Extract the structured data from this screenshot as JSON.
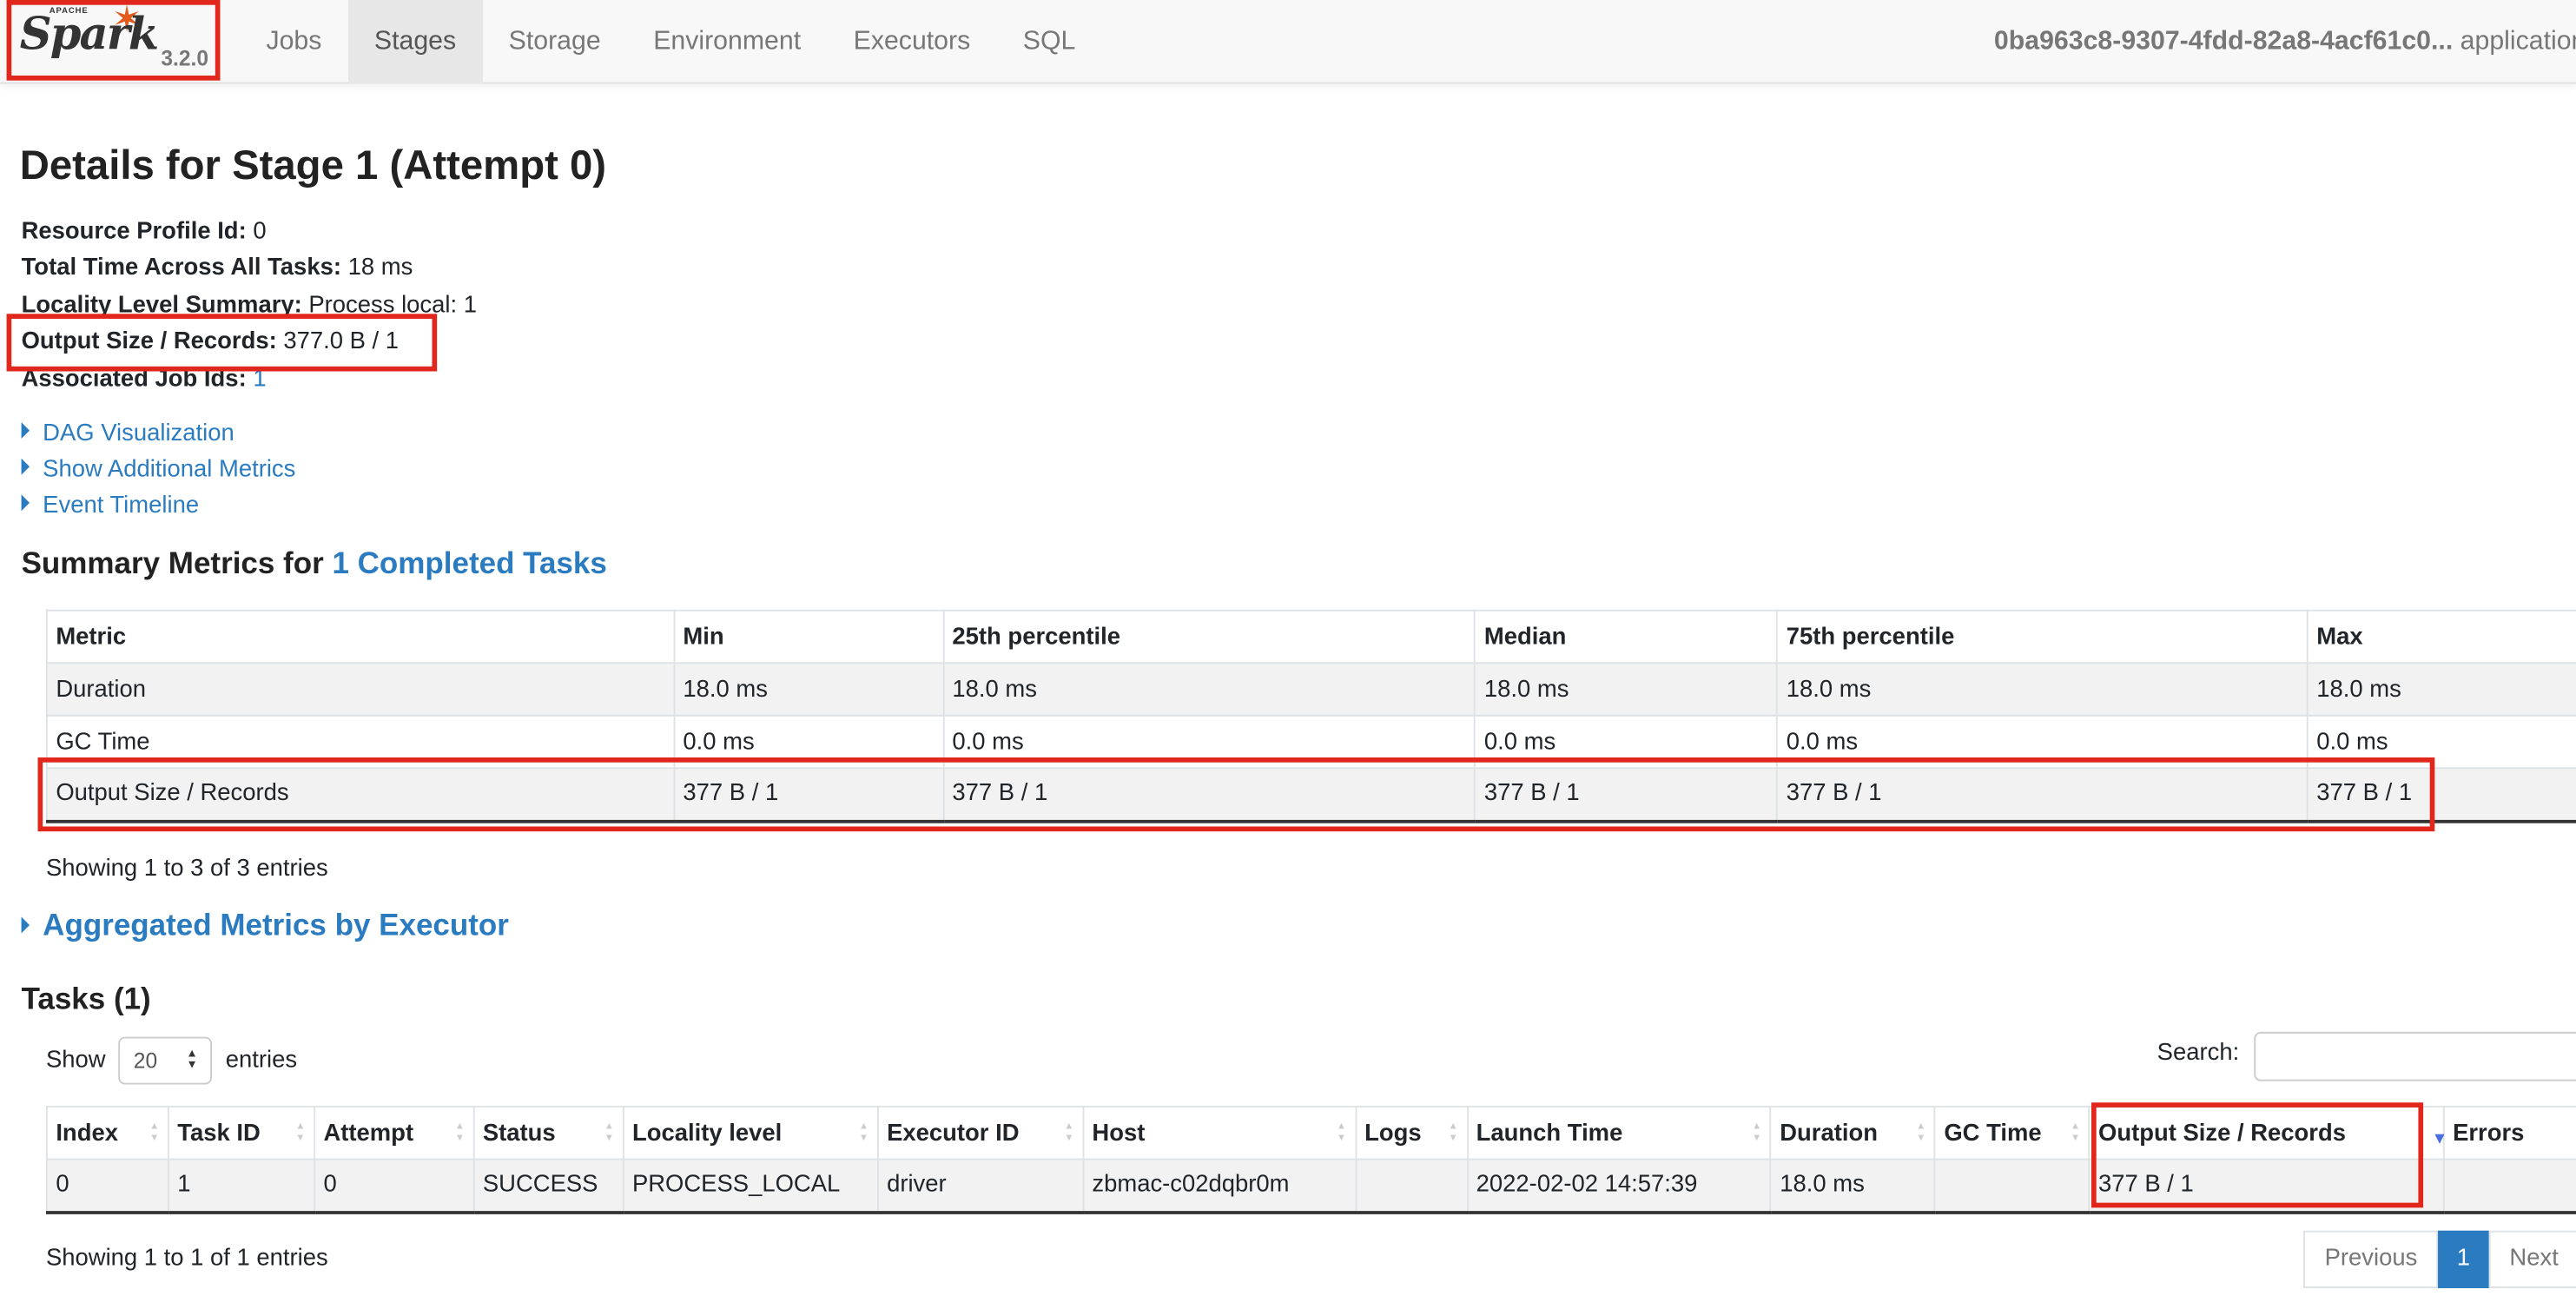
{
  "brand": {
    "apache": "APACHE",
    "name": "Spark",
    "version": "3.2.0"
  },
  "nav": {
    "items": [
      "Jobs",
      "Stages",
      "Storage",
      "Environment",
      "Executors",
      "SQL"
    ],
    "active": "Stages",
    "app_id": "0ba963c8-9307-4fdd-82a8-4acf61c0...",
    "app_suffix": " application"
  },
  "page": {
    "title": "Details for Stage 1 (Attempt 0)"
  },
  "summary": [
    {
      "label": "Resource Profile Id:",
      "value": " 0"
    },
    {
      "label": "Total Time Across All Tasks:",
      "value": " 18 ms"
    },
    {
      "label": "Locality Level Summary:",
      "value": " Process local: 1"
    },
    {
      "label": "Output Size / Records:",
      "value": " 377.0 B / 1"
    },
    {
      "label": "Associated Job Ids:",
      "value": " 1"
    }
  ],
  "toggles": [
    "DAG Visualization",
    "Show Additional Metrics",
    "Event Timeline"
  ],
  "metrics": {
    "heading_prefix": "Summary Metrics for ",
    "heading_link": "1 Completed Tasks",
    "columns": [
      "Metric",
      "Min",
      "25th percentile",
      "Median",
      "75th percentile",
      "Max"
    ],
    "rows": [
      [
        "Duration",
        "18.0 ms",
        "18.0 ms",
        "18.0 ms",
        "18.0 ms",
        "18.0 ms"
      ],
      [
        "GC Time",
        "0.0 ms",
        "0.0 ms",
        "0.0 ms",
        "0.0 ms",
        "0.0 ms"
      ],
      [
        "Output Size / Records",
        "377 B / 1",
        "377 B / 1",
        "377 B / 1",
        "377 B / 1",
        "377 B / 1"
      ]
    ],
    "info": "Showing 1 to 3 of 3 entries"
  },
  "aggregated": {
    "label": "Aggregated Metrics by Executor"
  },
  "tasks": {
    "heading": "Tasks (1)",
    "show_label": "Show",
    "page_length": "20",
    "entries_label": "entries",
    "search_label": "Search:",
    "search_value": "",
    "columns": [
      "Index",
      "Task ID",
      "Attempt",
      "Status",
      "Locality level",
      "Executor ID",
      "Host",
      "Logs",
      "Launch Time",
      "Duration",
      "GC Time",
      "Output Size / Records",
      "Errors"
    ],
    "rows": [
      [
        "0",
        "1",
        "0",
        "SUCCESS",
        "PROCESS_LOCAL",
        "driver",
        "zbmac-c02dqbr0m",
        "",
        "2022-02-02 14:57:39",
        "18.0 ms",
        "",
        "377 B / 1",
        ""
      ]
    ],
    "info": "Showing 1 to 1 of 1 entries",
    "pager": {
      "previous": "Previous",
      "current": "1",
      "next": "Next"
    }
  },
  "colors": {
    "link": "#2a7bc0",
    "highlight": "#e1261c",
    "spark_orange": "#e25a1c"
  }
}
